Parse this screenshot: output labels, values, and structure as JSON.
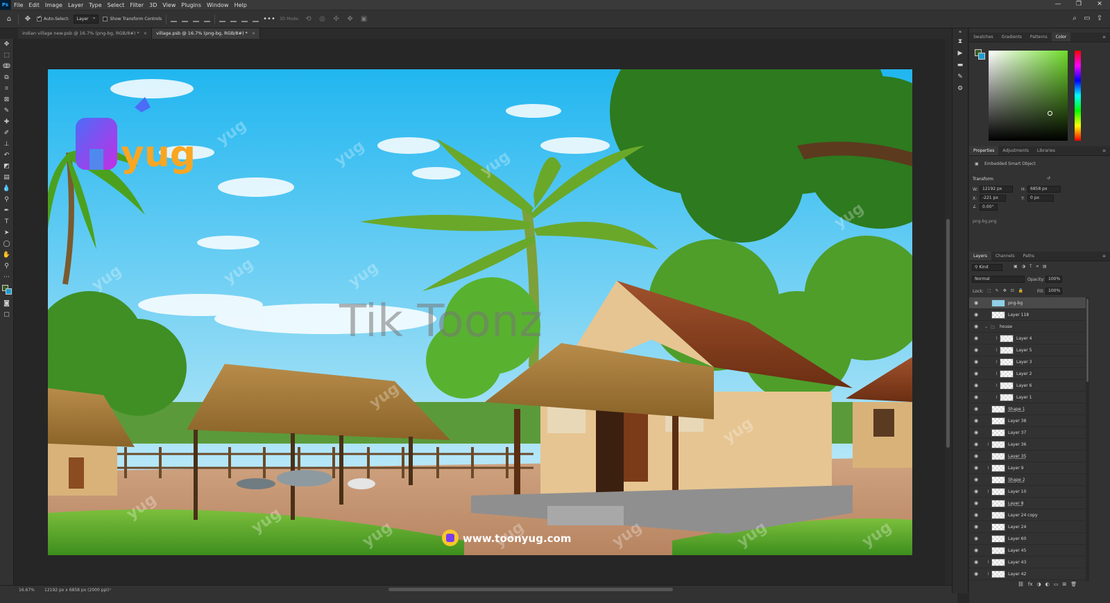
{
  "app": {
    "logo": "Ps"
  },
  "menu": [
    "File",
    "Edit",
    "Image",
    "Layer",
    "Type",
    "Select",
    "Filter",
    "3D",
    "View",
    "Plugins",
    "Window",
    "Help"
  ],
  "window_controls": {
    "minimize": "—",
    "restore": "❐",
    "close": "✕"
  },
  "options_bar": {
    "auto_select_label": "Auto-Select:",
    "auto_select_target": "Layer",
    "show_transform_label": "Show Transform Controls",
    "more": "•••",
    "mode_3d_label": "3D Mode:"
  },
  "tabs": [
    {
      "label": "indian village new.psb @ 16.7% (png-bg, RGB/8#) *",
      "close": "×"
    },
    {
      "label": "village.psb @ 16.7% (png-bg, RGB/8#) *",
      "close": "×"
    }
  ],
  "canvas": {
    "brand_logo": "Ayug",
    "watermark_small": "yug",
    "watermark_text": "Tik Toonz",
    "website": "www.toonyug.com"
  },
  "status": {
    "zoom": "16.67%",
    "doc_info": "12192 px x 6858 px (2000 ppi)",
    "arrow": "›"
  },
  "color_panel": {
    "tabs": [
      "Swatches",
      "Gradients",
      "Patterns",
      "Color"
    ],
    "active": "Color",
    "fg_color": "#3a5a23",
    "bg_color": "#1a9fd0",
    "hue_color": "#6fdc2a"
  },
  "properties_panel": {
    "tabs": [
      "Properties",
      "Adjustments",
      "Libraries"
    ],
    "active": "Properties",
    "type_label": "Embedded Smart Object",
    "section": "Transform",
    "w_label": "W:",
    "w_value": "12192 px",
    "h_label": "H:",
    "h_value": "6858 px",
    "x_label": "X:",
    "x_value": "-221 px",
    "y_label": "Y:",
    "y_value": "0 px",
    "angle_value": "0.00°",
    "filename": "png-bg.png"
  },
  "layers_panel": {
    "tabs": [
      "Layers",
      "Channels",
      "Paths"
    ],
    "active": "Layers",
    "kind_label": "Kind",
    "blend_mode": "Normal",
    "opacity_label": "Opacity:",
    "opacity_value": "100%",
    "lock_label": "Lock:",
    "fill_label": "Fill:",
    "fill_value": "100%",
    "layers": [
      {
        "name": "png-bg",
        "indent": 0,
        "selected": true,
        "smart": true
      },
      {
        "name": "Layer 118",
        "indent": 0
      },
      {
        "name": "house",
        "indent": 0,
        "folder": true
      },
      {
        "name": "Layer 4",
        "indent": 1,
        "linked": true
      },
      {
        "name": "Layer 5",
        "indent": 1,
        "linked": true
      },
      {
        "name": "Layer 3",
        "indent": 1,
        "linked": true
      },
      {
        "name": "Layer 2",
        "indent": 1,
        "linked": true
      },
      {
        "name": "Layer 6",
        "indent": 1,
        "linked": true
      },
      {
        "name": "Layer 1",
        "indent": 1,
        "linked": true
      },
      {
        "name": "Shape 1",
        "indent": 0,
        "underline": true
      },
      {
        "name": "Layer 38",
        "indent": 0
      },
      {
        "name": "Layer 37",
        "indent": 0
      },
      {
        "name": "Layer 36",
        "indent": 0,
        "linked": true
      },
      {
        "name": "Layer 35",
        "indent": 0,
        "underline": true
      },
      {
        "name": "Layer 9",
        "indent": 0,
        "linked": true
      },
      {
        "name": "Shape 2",
        "indent": 0,
        "underline": true
      },
      {
        "name": "Layer 10",
        "indent": 0,
        "linked": true
      },
      {
        "name": "Layer 8",
        "indent": 0,
        "underline": true
      },
      {
        "name": "Layer 24 copy",
        "indent": 0
      },
      {
        "name": "Layer 24",
        "indent": 0
      },
      {
        "name": "Layer 60",
        "indent": 0
      },
      {
        "name": "Layer 45",
        "indent": 0
      },
      {
        "name": "Layer 43",
        "indent": 0,
        "linked": true
      },
      {
        "name": "Layer 42",
        "indent": 0,
        "linked": true
      }
    ],
    "footer": [
      "⛓",
      "fx",
      "◑",
      "◐",
      "▭",
      "⊞",
      "🗑"
    ]
  }
}
